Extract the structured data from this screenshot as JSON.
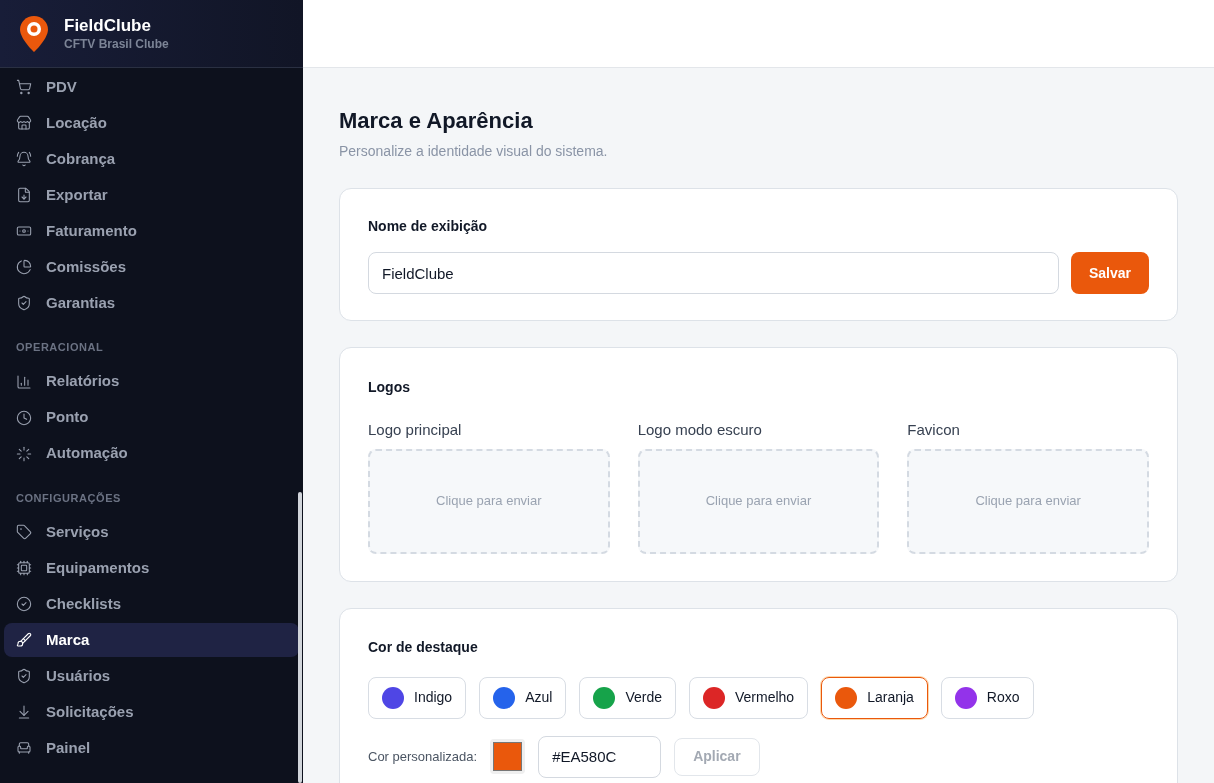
{
  "brand": {
    "name": "FieldClube",
    "subtitle": "CFTV Brasil Clube"
  },
  "sidebar": {
    "groups": [
      {
        "items": [
          {
            "label": "PDV",
            "selected": false
          },
          {
            "label": "Locação",
            "selected": false
          },
          {
            "label": "Cobrança",
            "selected": false
          },
          {
            "label": "Exportar",
            "selected": false
          },
          {
            "label": "Faturamento",
            "selected": false
          },
          {
            "label": "Comissões",
            "selected": false
          },
          {
            "label": "Garantias",
            "selected": false
          }
        ]
      },
      {
        "heading": "OPERACIONAL",
        "items": [
          {
            "label": "Relatórios",
            "selected": false
          },
          {
            "label": "Ponto",
            "selected": false
          },
          {
            "label": "Automação",
            "selected": false
          }
        ]
      },
      {
        "heading": "CONFIGURAÇÕES",
        "items": [
          {
            "label": "Serviços",
            "selected": false
          },
          {
            "label": "Equipamentos",
            "selected": false
          },
          {
            "label": "Checklists",
            "selected": false
          },
          {
            "label": "Marca",
            "selected": true
          },
          {
            "label": "Usuários",
            "selected": false
          },
          {
            "label": "Solicitações",
            "selected": false
          },
          {
            "label": "Painel",
            "selected": false
          }
        ]
      }
    ]
  },
  "page": {
    "title": "Marca e Aparência",
    "subtitle": "Personalize a identidade visual do sistema."
  },
  "display_name": {
    "title": "Nome de exibição",
    "value": "FieldClube",
    "button": "Salvar"
  },
  "logos": {
    "title": "Logos",
    "slots": [
      {
        "label": "Logo principal",
        "placeholder": "Clique para enviar"
      },
      {
        "label": "Logo modo escuro",
        "placeholder": "Clique para enviar"
      },
      {
        "label": "Favicon",
        "placeholder": "Clique para enviar"
      }
    ]
  },
  "accent": {
    "title": "Cor de destaque",
    "options": [
      {
        "label": "Indigo",
        "color": "#4f46e5",
        "selected": false
      },
      {
        "label": "Azul",
        "color": "#2563eb",
        "selected": false
      },
      {
        "label": "Verde",
        "color": "#16a34a",
        "selected": false
      },
      {
        "label": "Vermelho",
        "color": "#dc2626",
        "selected": false
      },
      {
        "label": "Laranja",
        "color": "#ea580c",
        "selected": true
      },
      {
        "label": "Roxo",
        "color": "#9333ea",
        "selected": false
      }
    ],
    "custom_label": "Cor personalizada:",
    "custom_value": "#EA580C",
    "apply": "Aplicar"
  }
}
